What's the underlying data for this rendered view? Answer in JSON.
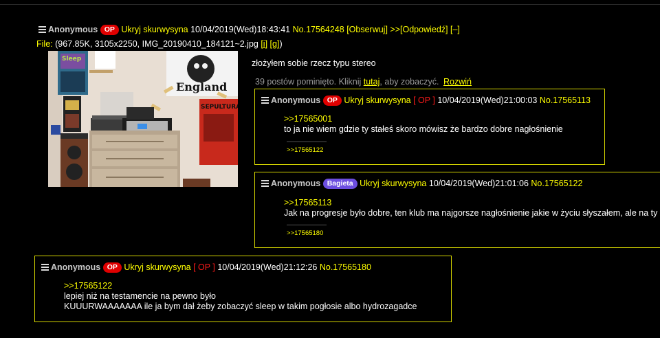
{
  "op": {
    "name": "Anonymous",
    "badge": "OP",
    "subject": "Ukryj skurwysyna",
    "date": "10/04/2019(Wed)18:43:41",
    "number": "No.17564248",
    "follow": "[Obserwuj]",
    "reply_arrows": ">>",
    "reply_label": "[Odpowiedź]",
    "collapse": "[–]",
    "file_label": "File:",
    "file_info": "(967.85K, 3105x2250, IMG_20190410_184121~2.jpg",
    "file_link_i": "[i]",
    "file_link_g": "[g]",
    "file_close": ")",
    "text": "złożyłem sobie rzecz typu stereo"
  },
  "omitted": {
    "prefix": "39 postów pominięto. Kliknij",
    "link": "tutaj",
    "suffix": ", aby zobaczyć.",
    "expand": "Rozwiń"
  },
  "replies": [
    {
      "name": "Anonymous",
      "badge": "OP",
      "subject": "Ukryj skurwysyna",
      "opmark": "[ OP ]",
      "date": "10/04/2019(Wed)21:00:03",
      "number": "No.17565113",
      "quote": ">>17565001",
      "lines": [
        "to ja nie wiem gdzie ty stałeś skoro mówisz że bardzo dobre nagłośnienie"
      ],
      "backlink": ">>17565122"
    },
    {
      "name": "Anonymous",
      "badge": "Bagieta",
      "subject": "Ukryj skurwysyna",
      "date": "10/04/2019(Wed)21:01:06",
      "number": "No.17565122",
      "quote": ">>17565113",
      "lines": [
        "Jak na progresje było dobre, ten klub ma najgorsze nagłośnienie jakie w życiu słyszałem, ale na ty"
      ],
      "backlink": ">>17565180"
    },
    {
      "name": "Anonymous",
      "badge": "OP",
      "subject": "Ukryj skurwysyna",
      "opmark": "[ OP ]",
      "date": "10/04/2019(Wed)21:12:26",
      "number": "No.17565180",
      "quote": ">>17565122",
      "lines": [
        "lepiej niż na testamencie na pewno było",
        "KUUURWAAAAAAA ile ja bym dał żeby zobaczyć sleep w takim pogłosie albo hydrozagadce"
      ]
    }
  ],
  "photo": {
    "poster_text_1": "Sleep",
    "poster_text_2": "England",
    "poster_text_3": "SEPULTURA"
  }
}
